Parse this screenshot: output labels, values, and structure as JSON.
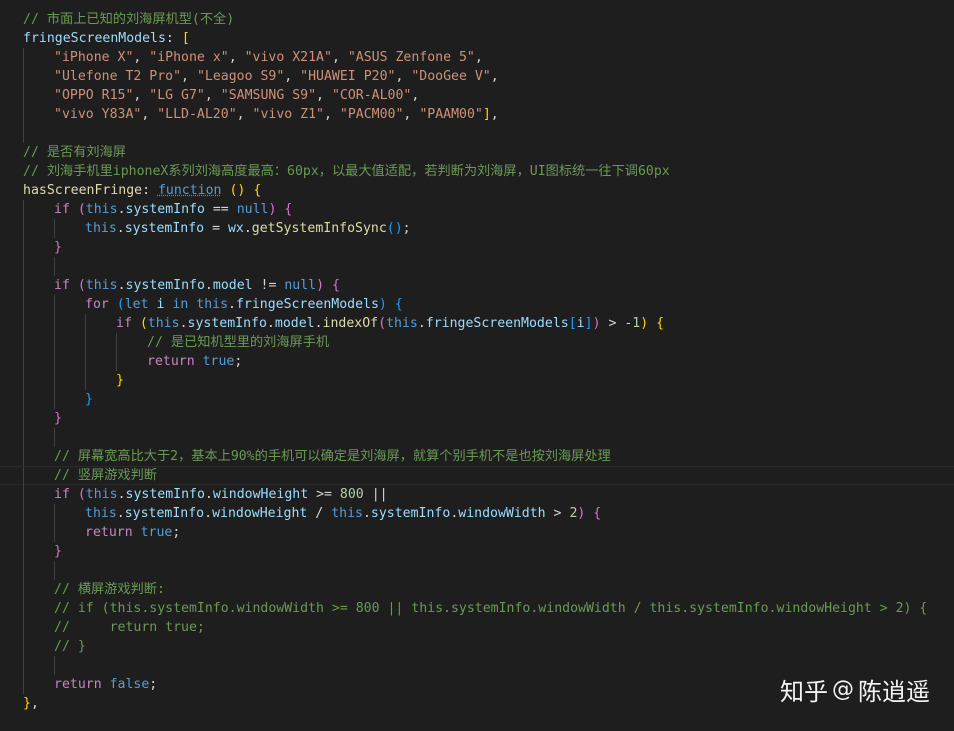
{
  "editor": {
    "lines": [
      {
        "indent": 0,
        "tokens": [
          [
            "com",
            "// 市面上已知的刘海屏机型(不全)"
          ]
        ]
      },
      {
        "indent": 0,
        "tokens": [
          [
            "prop",
            "fringeScreenModels"
          ],
          [
            "pl",
            ": "
          ],
          [
            "b1",
            "["
          ]
        ]
      },
      {
        "indent": 1,
        "tokens": [
          [
            "str",
            "\"iPhone X\""
          ],
          [
            "pl",
            ", "
          ],
          [
            "str",
            "\"iPhone x\""
          ],
          [
            "pl",
            ", "
          ],
          [
            "str",
            "\"vivo X21A\""
          ],
          [
            "pl",
            ", "
          ],
          [
            "str",
            "\"ASUS Zenfone 5\""
          ],
          [
            "pl",
            ","
          ]
        ]
      },
      {
        "indent": 1,
        "tokens": [
          [
            "str",
            "\"Ulefone T2 Pro\""
          ],
          [
            "pl",
            ", "
          ],
          [
            "str",
            "\"Leagoo S9\""
          ],
          [
            "pl",
            ", "
          ],
          [
            "str",
            "\"HUAWEI P20\""
          ],
          [
            "pl",
            ", "
          ],
          [
            "str",
            "\"DooGee V\""
          ],
          [
            "pl",
            ","
          ]
        ]
      },
      {
        "indent": 1,
        "tokens": [
          [
            "str",
            "\"OPPO R15\""
          ],
          [
            "pl",
            ", "
          ],
          [
            "str",
            "\"LG G7\""
          ],
          [
            "pl",
            ", "
          ],
          [
            "str",
            "\"SAMSUNG S9\""
          ],
          [
            "pl",
            ", "
          ],
          [
            "str",
            "\"COR-AL00\""
          ],
          [
            "pl",
            ","
          ]
        ]
      },
      {
        "indent": 1,
        "tokens": [
          [
            "str",
            "\"vivo Y83A\""
          ],
          [
            "pl",
            ", "
          ],
          [
            "str",
            "\"LLD-AL20\""
          ],
          [
            "pl",
            ", "
          ],
          [
            "str",
            "\"vivo Z1\""
          ],
          [
            "pl",
            ", "
          ],
          [
            "str",
            "\"PACM00\""
          ],
          [
            "pl",
            ", "
          ],
          [
            "str",
            "\"PAAM00\""
          ],
          [
            "b1",
            "]"
          ],
          [
            "pl",
            ","
          ]
        ]
      },
      {
        "indent": 0,
        "tokens": [],
        "guides": 1
      },
      {
        "indent": 0,
        "tokens": [
          [
            "com",
            "// 是否有刘海屏"
          ]
        ]
      },
      {
        "indent": 0,
        "tokens": [
          [
            "com",
            "// 刘海手机里iphoneX系列刘海高度最高：60px，以最大值适配，若判断为刘海屏，UI图标统一往下调60px"
          ]
        ]
      },
      {
        "indent": 0,
        "tokens": [
          [
            "fn",
            "hasScreenFringe"
          ],
          [
            "pl",
            ": "
          ],
          [
            "fnkw",
            "function"
          ],
          [
            "pl",
            " "
          ],
          [
            "b1",
            "()"
          ],
          [
            "pl",
            " "
          ],
          [
            "b1",
            "{"
          ]
        ]
      },
      {
        "indent": 1,
        "tokens": [
          [
            "ctl",
            "if"
          ],
          [
            "pl",
            " "
          ],
          [
            "b2",
            "("
          ],
          [
            "kw",
            "this"
          ],
          [
            "pl",
            "."
          ],
          [
            "prop",
            "systemInfo"
          ],
          [
            "pl",
            " == "
          ],
          [
            "kw",
            "null"
          ],
          [
            "b2",
            ")"
          ],
          [
            "pl",
            " "
          ],
          [
            "b2",
            "{"
          ]
        ]
      },
      {
        "indent": 2,
        "tokens": [
          [
            "kw",
            "this"
          ],
          [
            "pl",
            "."
          ],
          [
            "prop",
            "systemInfo"
          ],
          [
            "pl",
            " = "
          ],
          [
            "prop",
            "wx"
          ],
          [
            "pl",
            "."
          ],
          [
            "fn",
            "getSystemInfoSync"
          ],
          [
            "b3",
            "()"
          ],
          [
            "pl",
            ";"
          ]
        ]
      },
      {
        "indent": 1,
        "tokens": [
          [
            "b2",
            "}"
          ]
        ]
      },
      {
        "indent": 0,
        "tokens": [],
        "guides": 2
      },
      {
        "indent": 1,
        "tokens": [
          [
            "ctl",
            "if"
          ],
          [
            "pl",
            " "
          ],
          [
            "b2",
            "("
          ],
          [
            "kw",
            "this"
          ],
          [
            "pl",
            "."
          ],
          [
            "prop",
            "systemInfo"
          ],
          [
            "pl",
            "."
          ],
          [
            "prop",
            "model"
          ],
          [
            "pl",
            " != "
          ],
          [
            "kw",
            "null"
          ],
          [
            "b2",
            ")"
          ],
          [
            "pl",
            " "
          ],
          [
            "b2",
            "{"
          ]
        ]
      },
      {
        "indent": 2,
        "tokens": [
          [
            "ctl",
            "for"
          ],
          [
            "pl",
            " "
          ],
          [
            "b3",
            "("
          ],
          [
            "kw",
            "let"
          ],
          [
            "pl",
            " "
          ],
          [
            "prop",
            "i"
          ],
          [
            "pl",
            " "
          ],
          [
            "kw",
            "in"
          ],
          [
            "pl",
            " "
          ],
          [
            "kw",
            "this"
          ],
          [
            "pl",
            "."
          ],
          [
            "prop",
            "fringeScreenModels"
          ],
          [
            "b3",
            ")"
          ],
          [
            "pl",
            " "
          ],
          [
            "b3",
            "{"
          ]
        ]
      },
      {
        "indent": 3,
        "tokens": [
          [
            "ctl",
            "if"
          ],
          [
            "pl",
            " "
          ],
          [
            "b1",
            "("
          ],
          [
            "kw",
            "this"
          ],
          [
            "pl",
            "."
          ],
          [
            "prop",
            "systemInfo"
          ],
          [
            "pl",
            "."
          ],
          [
            "prop",
            "model"
          ],
          [
            "pl",
            "."
          ],
          [
            "fn",
            "indexOf"
          ],
          [
            "b2",
            "("
          ],
          [
            "kw",
            "this"
          ],
          [
            "pl",
            "."
          ],
          [
            "prop",
            "fringeScreenModels"
          ],
          [
            "b3",
            "["
          ],
          [
            "prop",
            "i"
          ],
          [
            "b3",
            "]"
          ],
          [
            "b2",
            ")"
          ],
          [
            "pl",
            " > -"
          ],
          [
            "num",
            "1"
          ],
          [
            "b1",
            ")"
          ],
          [
            "pl",
            " "
          ],
          [
            "b1",
            "{"
          ]
        ]
      },
      {
        "indent": 4,
        "tokens": [
          [
            "com",
            "// 是已知机型里的刘海屏手机"
          ]
        ]
      },
      {
        "indent": 4,
        "tokens": [
          [
            "ctl",
            "return"
          ],
          [
            "pl",
            " "
          ],
          [
            "kw",
            "true"
          ],
          [
            "pl",
            ";"
          ]
        ]
      },
      {
        "indent": 3,
        "tokens": [
          [
            "b1",
            "}"
          ]
        ]
      },
      {
        "indent": 2,
        "tokens": [
          [
            "b3",
            "}"
          ]
        ]
      },
      {
        "indent": 1,
        "tokens": [
          [
            "b2",
            "}"
          ]
        ]
      },
      {
        "indent": 0,
        "tokens": [],
        "guides": 2
      },
      {
        "indent": 1,
        "tokens": [
          [
            "com",
            "// 屏幕宽高比大于2，基本上90%的手机可以确定是刘海屏，就算个别手机不是也按刘海屏处理"
          ]
        ]
      },
      {
        "indent": 1,
        "tokens": [
          [
            "com",
            "// 竖屏游戏判断"
          ]
        ],
        "current": true
      },
      {
        "indent": 1,
        "tokens": [
          [
            "ctl",
            "if"
          ],
          [
            "pl",
            " "
          ],
          [
            "b2",
            "("
          ],
          [
            "kw",
            "this"
          ],
          [
            "pl",
            "."
          ],
          [
            "prop",
            "systemInfo"
          ],
          [
            "pl",
            "."
          ],
          [
            "prop",
            "windowHeight"
          ],
          [
            "pl",
            " >= "
          ],
          [
            "num",
            "800"
          ],
          [
            "pl",
            " ||"
          ]
        ]
      },
      {
        "indent": 2,
        "tokens": [
          [
            "kw",
            "this"
          ],
          [
            "pl",
            "."
          ],
          [
            "prop",
            "systemInfo"
          ],
          [
            "pl",
            "."
          ],
          [
            "prop",
            "windowHeight"
          ],
          [
            "pl",
            " / "
          ],
          [
            "kw",
            "this"
          ],
          [
            "pl",
            "."
          ],
          [
            "prop",
            "systemInfo"
          ],
          [
            "pl",
            "."
          ],
          [
            "prop",
            "windowWidth"
          ],
          [
            "pl",
            " > "
          ],
          [
            "num",
            "2"
          ],
          [
            "b2",
            ")"
          ],
          [
            "pl",
            " "
          ],
          [
            "b2",
            "{"
          ]
        ]
      },
      {
        "indent": 2,
        "tokens": [
          [
            "ctl",
            "return"
          ],
          [
            "pl",
            " "
          ],
          [
            "kw",
            "true"
          ],
          [
            "pl",
            ";"
          ]
        ]
      },
      {
        "indent": 1,
        "tokens": [
          [
            "b2",
            "}"
          ]
        ]
      },
      {
        "indent": 0,
        "tokens": [],
        "guides": 2
      },
      {
        "indent": 1,
        "tokens": [
          [
            "com",
            "// 横屏游戏判断:"
          ]
        ]
      },
      {
        "indent": 1,
        "tokens": [
          [
            "com",
            "// if (this.systemInfo.windowWidth >= 800 || this.systemInfo.windowWidth / this.systemInfo.windowHeight > 2) {"
          ]
        ]
      },
      {
        "indent": 1,
        "tokens": [
          [
            "com",
            "//     return true;"
          ]
        ]
      },
      {
        "indent": 1,
        "tokens": [
          [
            "com",
            "// }"
          ]
        ]
      },
      {
        "indent": 0,
        "tokens": [],
        "guides": 2
      },
      {
        "indent": 1,
        "tokens": [
          [
            "ctl",
            "return"
          ],
          [
            "pl",
            " "
          ],
          [
            "kw",
            "false"
          ],
          [
            "pl",
            ";"
          ]
        ]
      },
      {
        "indent": 0,
        "tokens": [
          [
            "b1",
            "}"
          ],
          [
            "pl",
            ","
          ]
        ]
      }
    ]
  },
  "watermark": {
    "brand": "知乎",
    "at": "@",
    "author": "陈逍遥"
  }
}
